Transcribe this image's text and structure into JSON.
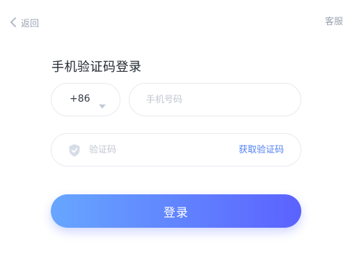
{
  "header": {
    "back_label": "返回",
    "back_icon": "chevron-left-icon",
    "service_label": "客服"
  },
  "form": {
    "title": "手机验证码登录",
    "country_code": "+86",
    "country_caret_icon": "caret-down-icon",
    "phone_value": "",
    "phone_placeholder": "手机号码",
    "code_icon": "shield-check-icon",
    "code_value": "",
    "code_placeholder": "验证码",
    "get_code_label": "获取验证码",
    "submit_label": "登录"
  },
  "colors": {
    "accent": "#4f7ff0",
    "button_gradient_start": "#67a6ff",
    "button_gradient_end": "#5b62ff",
    "muted_text": "#9aa3b2",
    "border": "#e6e9ef"
  }
}
